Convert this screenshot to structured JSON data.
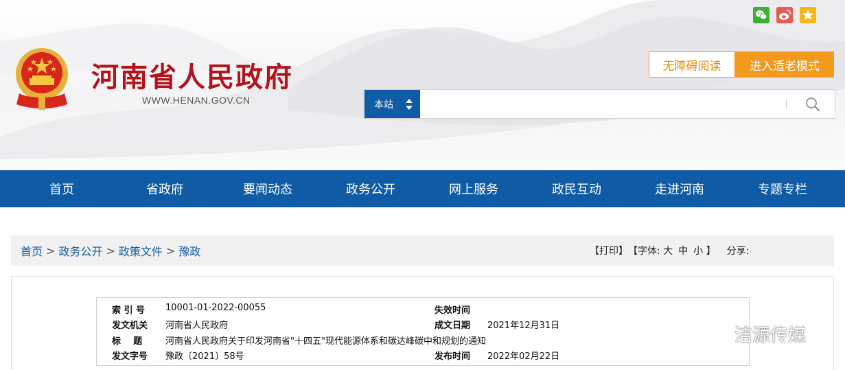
{
  "header": {
    "site_title": "河南省人民政府",
    "site_url": "WWW.HENAN.GOV.CN",
    "accessibility_button": "无障碍阅读",
    "elder_mode_button": "进入适老模式",
    "search": {
      "scope": "本站",
      "value": "",
      "placeholder": ""
    }
  },
  "nav": {
    "items": [
      "首页",
      "省政府",
      "要闻动态",
      "政务公开",
      "网上服务",
      "政民互动",
      "走进河南",
      "专题专栏"
    ]
  },
  "breadcrumb": {
    "items": [
      "首页",
      "政务公开",
      "政策文件",
      "豫政"
    ],
    "separator": ">"
  },
  "tools": {
    "print": "【打印】",
    "font_prefix": "【字体: ",
    "font_large": "大",
    "font_medium": "中",
    "font_small": "小",
    "font_suffix": " 】",
    "share_label": "分享:"
  },
  "meta": {
    "index_label": "索 引 号",
    "index_value": "10001-01-2022-00055",
    "expire_label": "失效时间",
    "expire_value": "",
    "issuer_label": "发文机关",
    "issuer_value": "河南省人民政府",
    "created_label": "成文日期",
    "created_value": "2021年12月31日",
    "title_label": "标    题",
    "title_value": "河南省人民政府关于印发河南省\"十四五\"现代能源体系和碳达峰碳中和规划的通知",
    "docno_label": "发文字号",
    "docno_value": "豫政〔2021〕58号",
    "published_label": "发布时间",
    "published_value": "2022年02月22日"
  },
  "watermark": {
    "text": "洁源传媒"
  },
  "colors": {
    "brand_red": "#b3131b",
    "nav_blue": "#0f5ba5",
    "accent_orange": "#f39a1e"
  }
}
